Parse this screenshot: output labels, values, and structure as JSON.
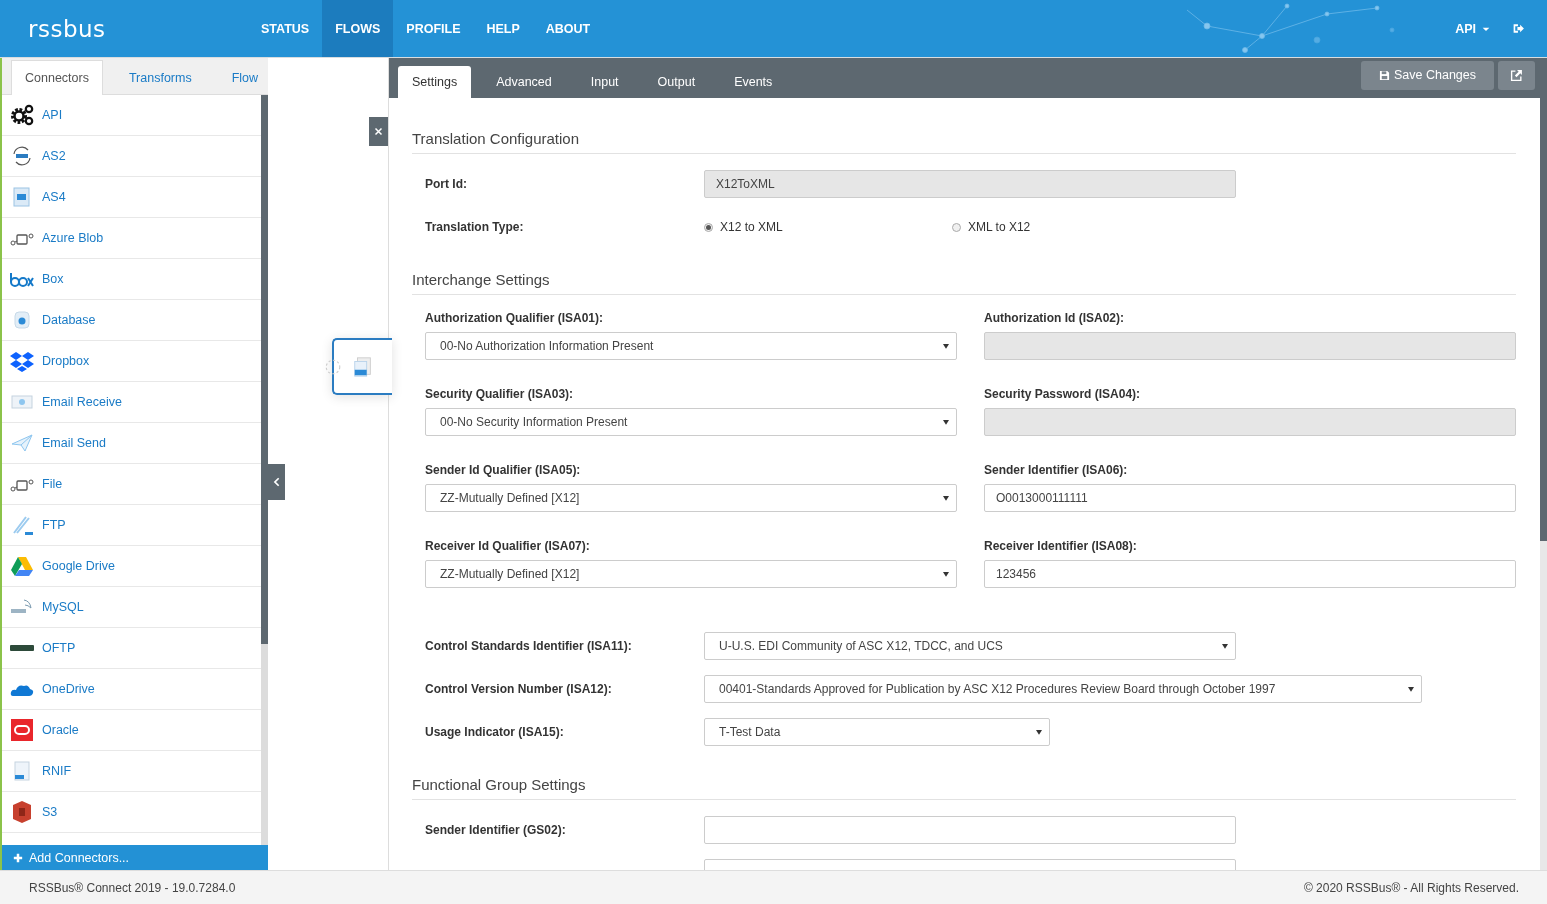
{
  "header": {
    "logo": "rssbus",
    "nav": [
      {
        "label": "STATUS",
        "selected": false
      },
      {
        "label": "FLOWS",
        "selected": true
      },
      {
        "label": "PROFILE",
        "selected": false
      },
      {
        "label": "HELP",
        "selected": false
      },
      {
        "label": "ABOUT",
        "selected": false
      }
    ],
    "user": "API"
  },
  "sidebar": {
    "tabs": [
      {
        "label": "Connectors",
        "selected": true
      },
      {
        "label": "Transforms",
        "selected": false
      },
      {
        "label": "Flow",
        "selected": false
      }
    ],
    "connectors": [
      {
        "label": "API"
      },
      {
        "label": "AS2"
      },
      {
        "label": "AS4"
      },
      {
        "label": "Azure Blob"
      },
      {
        "label": "Box"
      },
      {
        "label": "Database"
      },
      {
        "label": "Dropbox"
      },
      {
        "label": "Email Receive"
      },
      {
        "label": "Email Send"
      },
      {
        "label": "File"
      },
      {
        "label": "FTP"
      },
      {
        "label": "Google Drive"
      },
      {
        "label": "MySQL"
      },
      {
        "label": "OFTP"
      },
      {
        "label": "OneDrive"
      },
      {
        "label": "Oracle"
      },
      {
        "label": "RNIF"
      },
      {
        "label": "S3"
      }
    ],
    "add_button": "Add Connectors..."
  },
  "panel": {
    "tabs": [
      {
        "label": "Settings",
        "selected": true
      },
      {
        "label": "Advanced",
        "selected": false
      },
      {
        "label": "Input",
        "selected": false
      },
      {
        "label": "Output",
        "selected": false
      },
      {
        "label": "Events",
        "selected": false
      }
    ],
    "save_button": "Save Changes",
    "sections": [
      {
        "title": "Translation Configuration",
        "rows": [
          {
            "kind": "text",
            "label": "Port Id:",
            "value": "X12ToXML",
            "disabled": true
          },
          {
            "kind": "radio",
            "label": "Translation Type:",
            "options": [
              {
                "label": "X12 to XML",
                "selected": true
              },
              {
                "label": "XML to X12",
                "selected": false
              }
            ]
          }
        ]
      },
      {
        "title": "Interchange Settings",
        "rows": [
          {
            "kind": "pair",
            "fields": [
              {
                "kind": "select",
                "label": "Authorization Qualifier (ISA01):",
                "value": "00-No Authorization Information Present"
              },
              {
                "kind": "text",
                "label": "Authorization Id (ISA02):",
                "disabled": true
              }
            ]
          },
          {
            "kind": "pair",
            "fields": [
              {
                "kind": "select",
                "label": "Security Qualifier (ISA03):",
                "value": "00-No Security Information Present"
              },
              {
                "kind": "text",
                "label": "Security Password (ISA04):",
                "disabled": true
              }
            ]
          },
          {
            "kind": "pair",
            "fields": [
              {
                "kind": "select",
                "label": "Sender Id Qualifier (ISA05):",
                "value": "ZZ-Mutually Defined [X12]"
              },
              {
                "kind": "text",
                "label": "Sender Identifier (ISA06):",
                "value": "O0013000111111",
                "disabled": false
              }
            ]
          },
          {
            "kind": "pair",
            "fields": [
              {
                "kind": "select",
                "label": "Receiver Id Qualifier (ISA07):",
                "value": "ZZ-Mutually Defined [X12]"
              },
              {
                "kind": "text",
                "label": "Receiver Identifier (ISA08):",
                "value": "123456",
                "disabled": false
              }
            ]
          },
          {
            "kind": "select",
            "label": "Control Standards Identifier (ISA11):",
            "value": "U-U.S. EDI Community of ASC X12, TDCC, and UCS"
          },
          {
            "kind": "select",
            "label": "Control Version Number (ISA12):",
            "value": "00401-Standards Approved for Publication by ASC X12 Procedures Review Board through October 1997"
          },
          {
            "kind": "select",
            "label": "Usage Indicator (ISA15):",
            "value": "T-Test Data"
          }
        ]
      },
      {
        "title": "Functional Group Settings",
        "rows": [
          {
            "kind": "text",
            "label": "Sender Identifier (GS02):",
            "disabled": false
          },
          {
            "kind": "text",
            "disabled": false
          }
        ]
      }
    ]
  },
  "footer": {
    "version": "RSSBus® Connect 2019 - 19.0.7284.0",
    "copyright": "© 2020 RSSBus® - All Rights Reserved."
  }
}
